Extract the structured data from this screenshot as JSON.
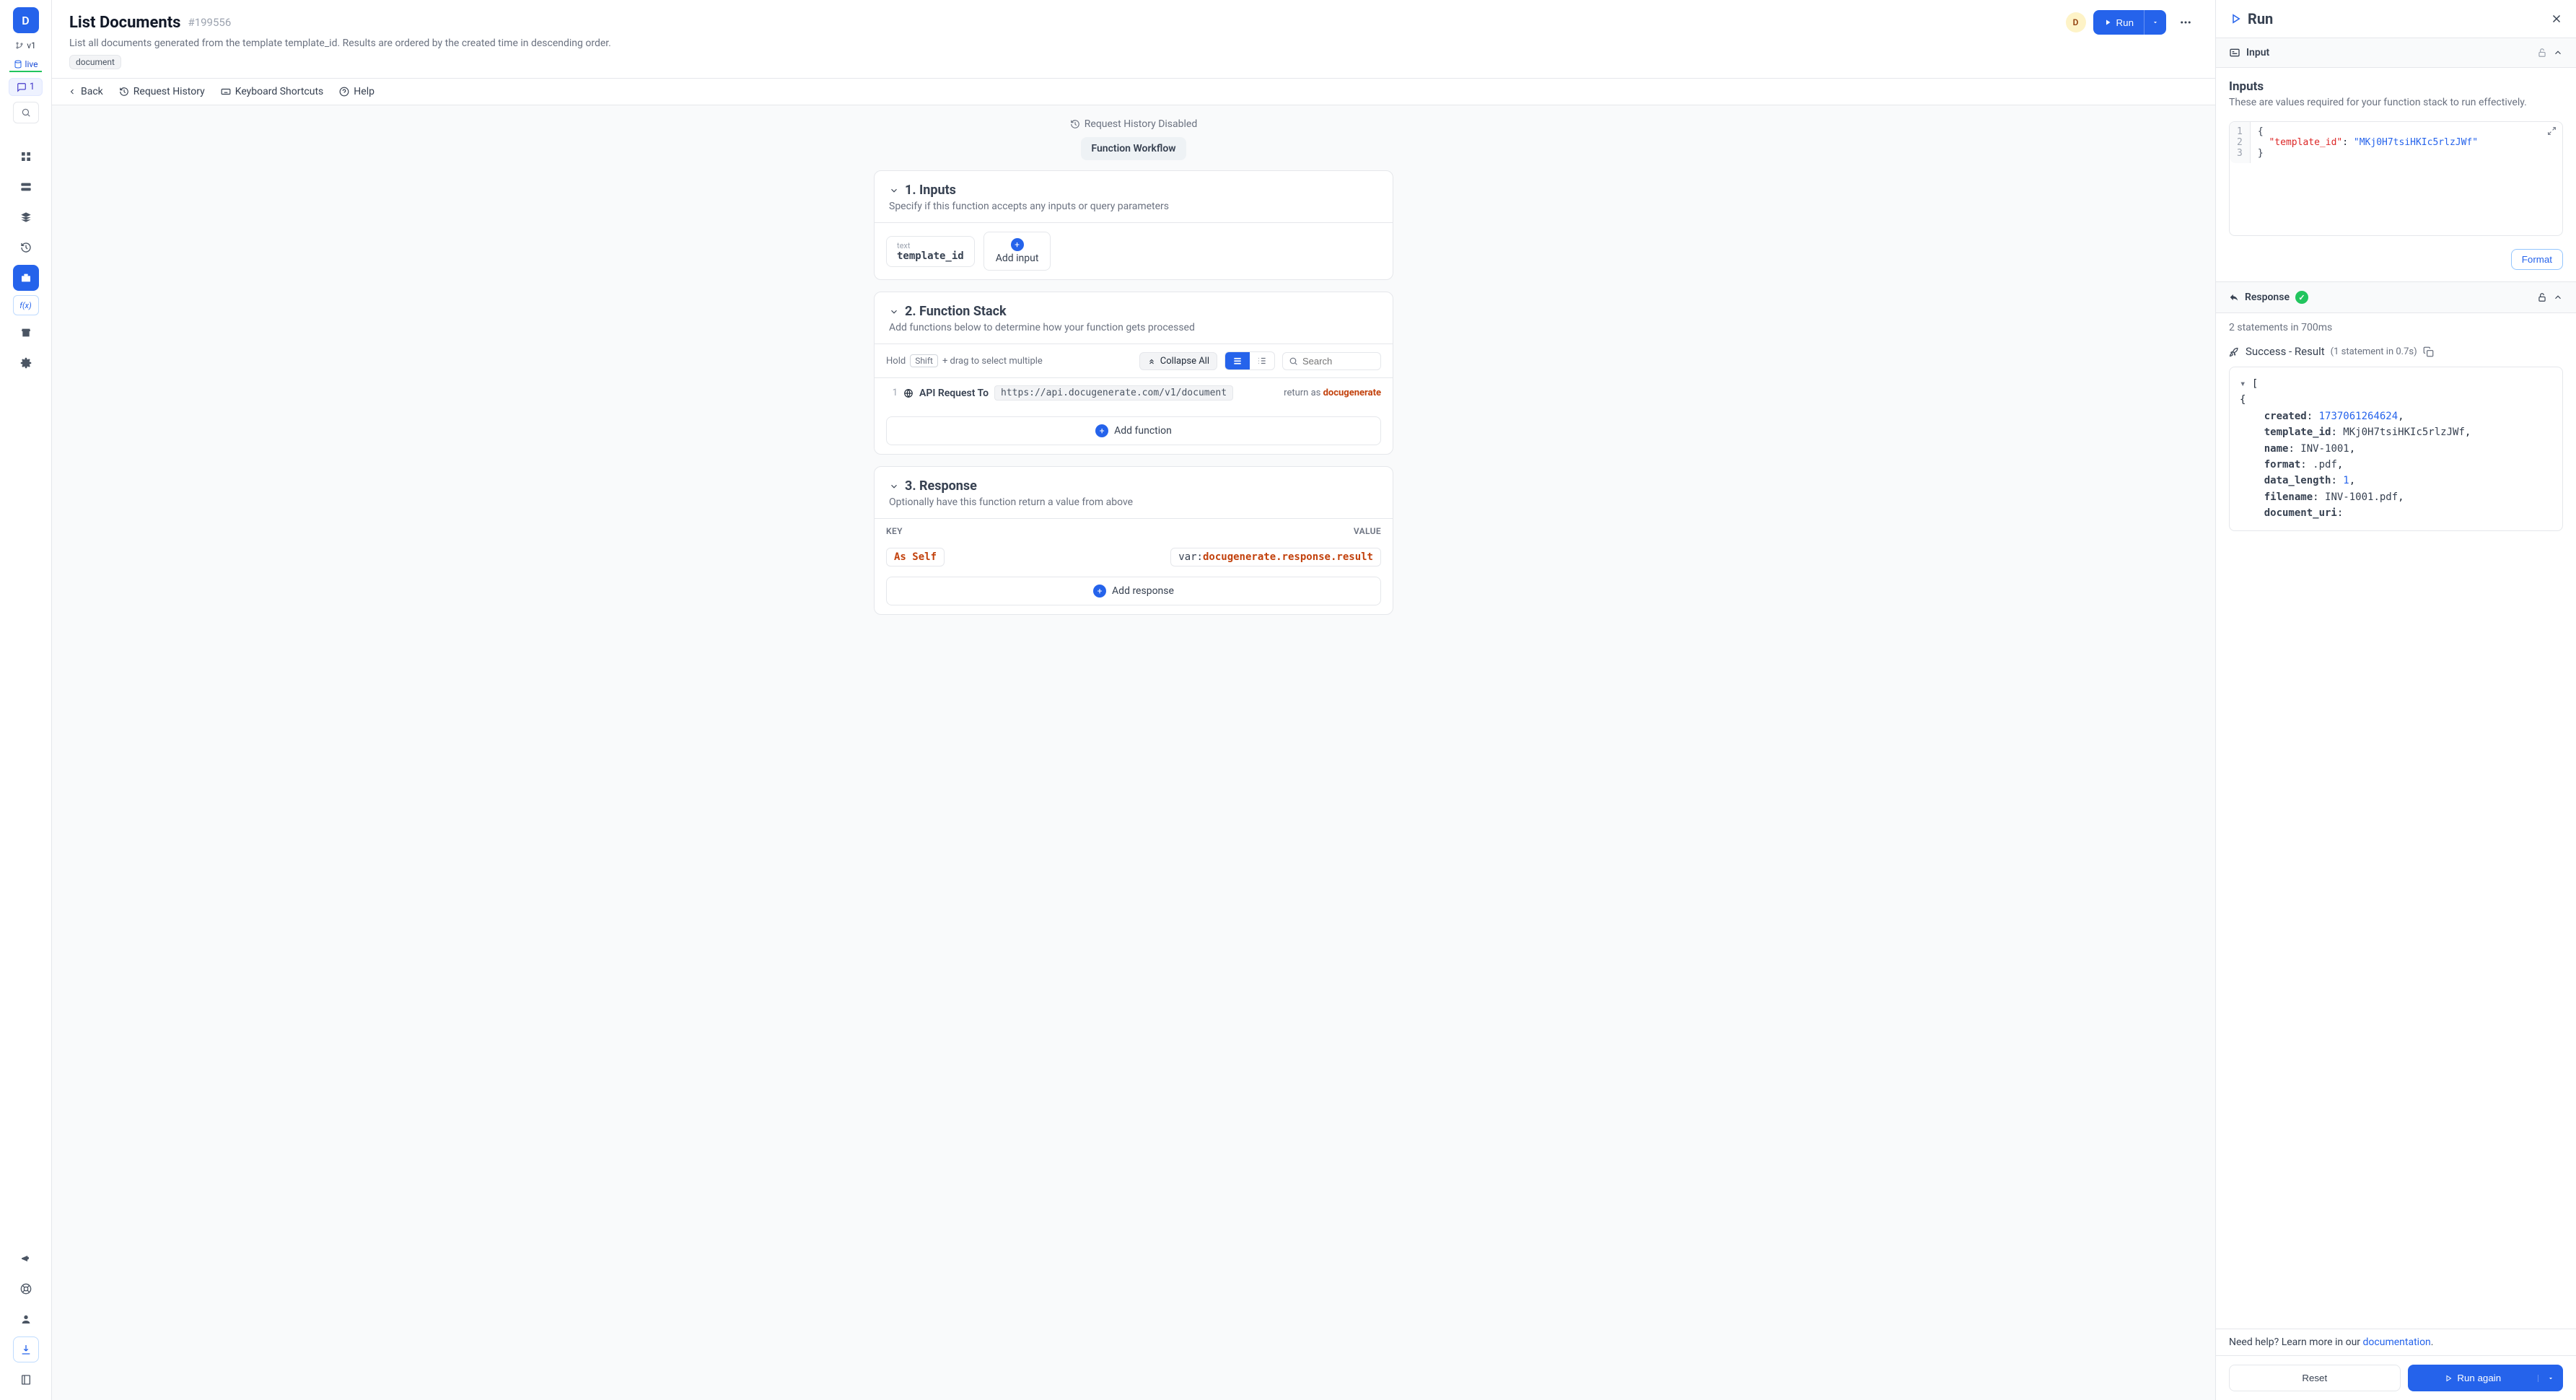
{
  "sidebar": {
    "workspace_letter": "D",
    "branch_label": "v1",
    "env_label": "live",
    "comments_count": "1",
    "fx_label": "f(x)"
  },
  "header": {
    "title": "List Documents",
    "hash": "#199556",
    "description": "List all documents generated from the template template_id. Results are ordered by the created time in descending order.",
    "tag": "document",
    "avatar_letter": "D",
    "run_label": "Run"
  },
  "crumbs": {
    "back": "Back",
    "history": "Request History",
    "shortcuts": "Keyboard Shortcuts",
    "help": "Help"
  },
  "canvas": {
    "history_disabled": "Request History Disabled",
    "workflow_label": "Function Workflow",
    "sec1_title": "1. Inputs",
    "sec1_sub": "Specify if this function accepts any inputs or query parameters",
    "input_type": "text",
    "input_name": "template_id",
    "add_input": "Add input",
    "sec2_title": "2. Function Stack",
    "sec2_sub": "Add functions below to determine how your function gets processed",
    "hold": "Hold",
    "shift": "Shift",
    "drag_hint": "+ drag to select multiple",
    "collapse": "Collapse All",
    "search_placeholder": "Search",
    "row1_num": "1",
    "row1_label": "API Request To",
    "row1_url": "https://api.docugenerate.com/v1/document",
    "row1_ret_pre": "return as ",
    "row1_ret_var": "docugenerate",
    "add_function": "Add function",
    "sec3_title": "3. Response",
    "sec3_sub": "Optionally have this function return a value from above",
    "key_h": "KEY",
    "value_h": "VALUE",
    "as_self": "As Self",
    "resp_var_pre": "var:",
    "resp_var_val": "docugenerate.response.result",
    "add_response": "Add response"
  },
  "panel": {
    "run_title": "Run",
    "input_section": "Input",
    "inputs_h": "Inputs",
    "inputs_sub": "These are values required for your function stack to run effectively.",
    "code_l1": "{",
    "code_l2_key": "\"template_id\"",
    "code_l2_sep": ": ",
    "code_l2_val": "\"MKj0H7tsiHKIc5rlzJWf\"",
    "code_l3": "}",
    "format": "Format",
    "response_section": "Response",
    "stats": "2 statements in 700ms",
    "success": "Success - Result",
    "success_sub": "(1 statement in 0.7s)",
    "help_text": "Need help? Learn more in our ",
    "help_link": "documentation",
    "reset": "Reset",
    "run_again": "Run again"
  },
  "chart_data": {
    "type": "table",
    "result": [
      {
        "created": 1737061264624,
        "template_id": "MKj0H7tsiHKIc5rlzJWf",
        "name": "INV-1001",
        "format": ".pdf",
        "data_length": 1,
        "filename": "INV-1001.pdf",
        "document_uri": ""
      }
    ]
  },
  "json_lines": [
    {
      "indent": 0,
      "text_before": "[",
      "key": "",
      "val": "",
      "cls": ""
    },
    {
      "indent": 0,
      "text_before": "{",
      "key": "",
      "val": "",
      "cls": ""
    },
    {
      "indent": 1,
      "text_before": "",
      "key": "created",
      "val": "1737061264624",
      "cls": "jn",
      "comma": ","
    },
    {
      "indent": 1,
      "text_before": "",
      "key": "template_id",
      "val": "MKj0H7tsiHKIc5rlzJWf",
      "cls": "js",
      "comma": ","
    },
    {
      "indent": 1,
      "text_before": "",
      "key": "name",
      "val": "INV-1001",
      "cls": "js",
      "comma": ","
    },
    {
      "indent": 1,
      "text_before": "",
      "key": "format",
      "val": ".pdf",
      "cls": "js",
      "comma": ","
    },
    {
      "indent": 1,
      "text_before": "",
      "key": "data_length",
      "val": "1",
      "cls": "jn",
      "comma": ","
    },
    {
      "indent": 1,
      "text_before": "",
      "key": "filename",
      "val": "INV-1001.pdf",
      "cls": "js",
      "comma": ","
    },
    {
      "indent": 1,
      "text_before": "",
      "key": "document_uri",
      "val": "",
      "cls": "js",
      "comma": ""
    }
  ]
}
